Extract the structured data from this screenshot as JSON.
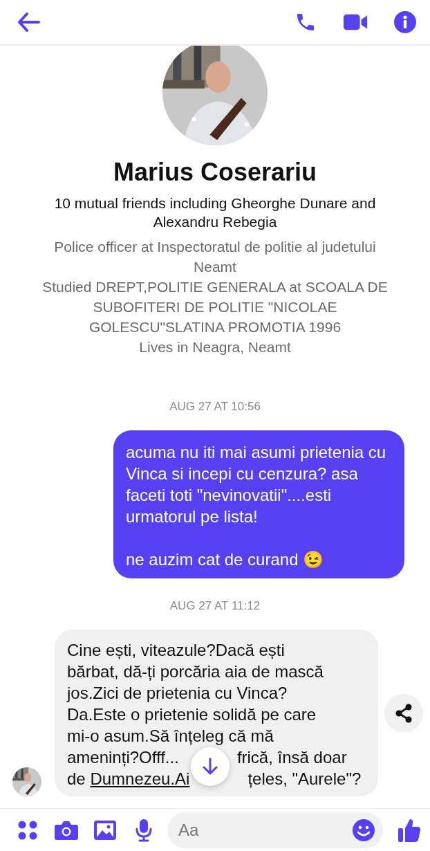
{
  "profile": {
    "name": "Marius Coserariu",
    "mutual_friends": "10 mutual friends including Gheorghe Dunare and Alexandru Rebegia",
    "details": [
      "Police officer at Inspectoratul de politie al judetului Neamt",
      "Studied DREPT,POLITIE GENERALA at SCOALA DE SUBOFITERI DE POLITIE \"NICOLAE GOLESCU\"SLATINA PROMOTIA 1996",
      "Lives in Neagra, Neamt"
    ]
  },
  "messages": [
    {
      "kind": "timestamp",
      "text": "AUG 27 AT 10:56"
    },
    {
      "kind": "sent",
      "text": "acuma nu iti mai asumi prietenia cu Vinca si incepi cu cenzura? asa faceti toti \"nevinovatii\"....esti urmatorul pe lista!\n\nne auzim cat de curand 😉"
    },
    {
      "kind": "timestamp",
      "text": "AUG 27 AT 11:12"
    },
    {
      "kind": "received",
      "segments": [
        {
          "text": "Cine ești, viteazule?Dacă ești\nbărbat, dă-ți porcăria aia de mască\njos.Zici de prietenia cu Vinca?\nDa.Este o prietenie solidă pe care\nmi-o asum.Să înțeleg că mă\nameninți?Offf...",
          "link": false,
          "covered_before": false
        },
        {
          "text": "frică, însă doar\nde ",
          "link": false,
          "covered_before": true
        },
        {
          "text": "Dumnezeu.Ai",
          "link": true,
          "covered_before": false
        },
        {
          "text": "țeles, \"Aurele\"?",
          "link": false,
          "covered_before": true
        }
      ]
    }
  ],
  "composer": {
    "placeholder": "Aa"
  }
}
